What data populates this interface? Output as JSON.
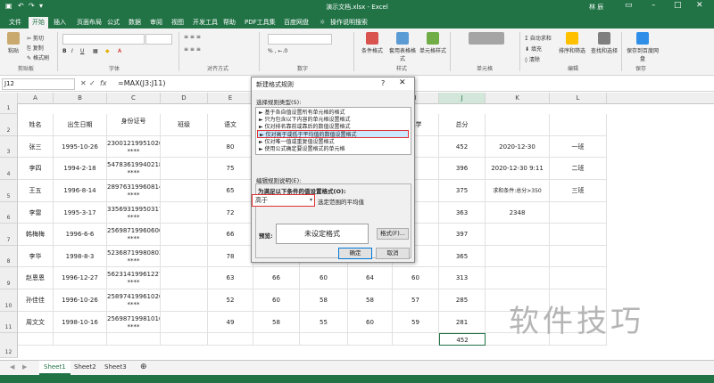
{
  "titlebar": {
    "title": "演示文档.xlsx - Excel",
    "user": "林 辰"
  },
  "tabs": [
    "文件",
    "开始",
    "插入",
    "页面布局",
    "公式",
    "数据",
    "审阅",
    "视图",
    "开发工具",
    "帮助",
    "PDF工具集",
    "百度网盘",
    "操作说明搜索"
  ],
  "ribbon": {
    "clipboard": {
      "paste": "粘贴",
      "cut": "剪切",
      "copy": "复制",
      "format_painter": "格式刷",
      "group": "剪贴板"
    },
    "font_group": "字体",
    "align_group": "对齐方式",
    "number_group": "数字",
    "styles": {
      "cond": "条件格式",
      "table": "套用表格格式",
      "cell": "单元格样式",
      "group": "样式"
    },
    "cells": {
      "label": "单元格"
    },
    "editing": {
      "autosum": "自动求和",
      "fill": "填充",
      "clear": "清除",
      "sort": "排序和筛选",
      "find": "查找和选择",
      "group": "编辑"
    },
    "save": {
      "label": "保存到百度网盘",
      "group": "保存"
    }
  },
  "formula_bar": {
    "cell": "J12",
    "formula": "=MAX(J3:J11)"
  },
  "columns": [
    "A",
    "B",
    "C",
    "D",
    "E",
    "F",
    "G",
    "H",
    "I",
    "J",
    "K",
    "L"
  ],
  "row_numbers": [
    "1",
    "2",
    "3",
    "4",
    "5",
    "6",
    "7",
    "8",
    "9",
    "10",
    "11",
    "12"
  ],
  "rows": [
    [
      "姓名",
      "出生日期",
      "身份证号",
      "班级",
      "语文",
      "",
      "",
      "",
      "化学",
      "总分",
      "",
      ""
    ],
    [
      "张三",
      "1995-10-26",
      "23001219951026 ****",
      "",
      "80",
      "",
      "",
      "",
      "",
      "452",
      "2020-12-30",
      "一班"
    ],
    [
      "李四",
      "1994-2-18",
      "54783619940218 ****",
      "",
      "75",
      "",
      "",
      "",
      "",
      "396",
      "2020-12-30 9:11",
      "二班"
    ],
    [
      "王五",
      "1996-8-14",
      "28976319960814 ****",
      "",
      "65",
      "",
      "",
      "",
      "",
      "375",
      "求和条件:总分>350",
      "三班"
    ],
    [
      "李雷",
      "1995-3-17",
      "33569319950317 ****",
      "",
      "72",
      "",
      "",
      "",
      "",
      "363",
      "2348",
      ""
    ],
    [
      "韩梅梅",
      "1996-6-6",
      "25698719960606 ****",
      "",
      "66",
      "",
      "",
      "",
      "",
      "397",
      "",
      ""
    ],
    [
      "李华",
      "1998-8-3",
      "52368719980803 ****",
      "",
      "78",
      "",
      "",
      "",
      "",
      "365",
      "",
      ""
    ],
    [
      "赵恩恩",
      "1996-12-27",
      "56231419961227 ****",
      "",
      "63",
      "66",
      "60",
      "64",
      "60",
      "313",
      "",
      ""
    ],
    [
      "孙佳佳",
      "1996-10-26",
      "25897419961026 ****",
      "",
      "52",
      "60",
      "58",
      "58",
      "57",
      "285",
      "",
      ""
    ],
    [
      "周文文",
      "1998-10-16",
      "25698719981016 ****",
      "",
      "49",
      "58",
      "55",
      "60",
      "59",
      "281",
      "",
      ""
    ],
    [
      "",
      "",
      "",
      "",
      "",
      "",
      "",
      "",
      "",
      "452",
      "",
      ""
    ]
  ],
  "sheets": [
    "Sheet1",
    "Sheet2",
    "Sheet3"
  ],
  "dialog": {
    "title": "新建格式规则",
    "help": "?",
    "rule_type_label": "选择规则类型(S):",
    "rule_types": [
      "► 基于各自值设置所有单元格的格式",
      "► 只为包含以下内容的单元格设置格式",
      "► 仅对排名靠前或靠后的数值设置格式",
      "► 仅对高于或低于平均值的数值设置格式",
      "► 仅对唯一值或重复值设置格式",
      "► 使用公式确定要设置格式的单元格"
    ],
    "edit_label": "编辑规则说明(E):",
    "condition_label": "为满足以下条件的值设置格式(O):",
    "dropdown_value": "高于",
    "dropdown_suffix": "选定范围的平均值",
    "preview_label": "预览:",
    "preview_text": "未设定格式",
    "format_btn": "格式(F)...",
    "ok": "确定",
    "cancel": "取消"
  },
  "watermark": "软件技巧",
  "colors": {
    "excel_green": "#217346",
    "highlight_red": "#e03030",
    "selected_blue": "#cce8ff"
  }
}
